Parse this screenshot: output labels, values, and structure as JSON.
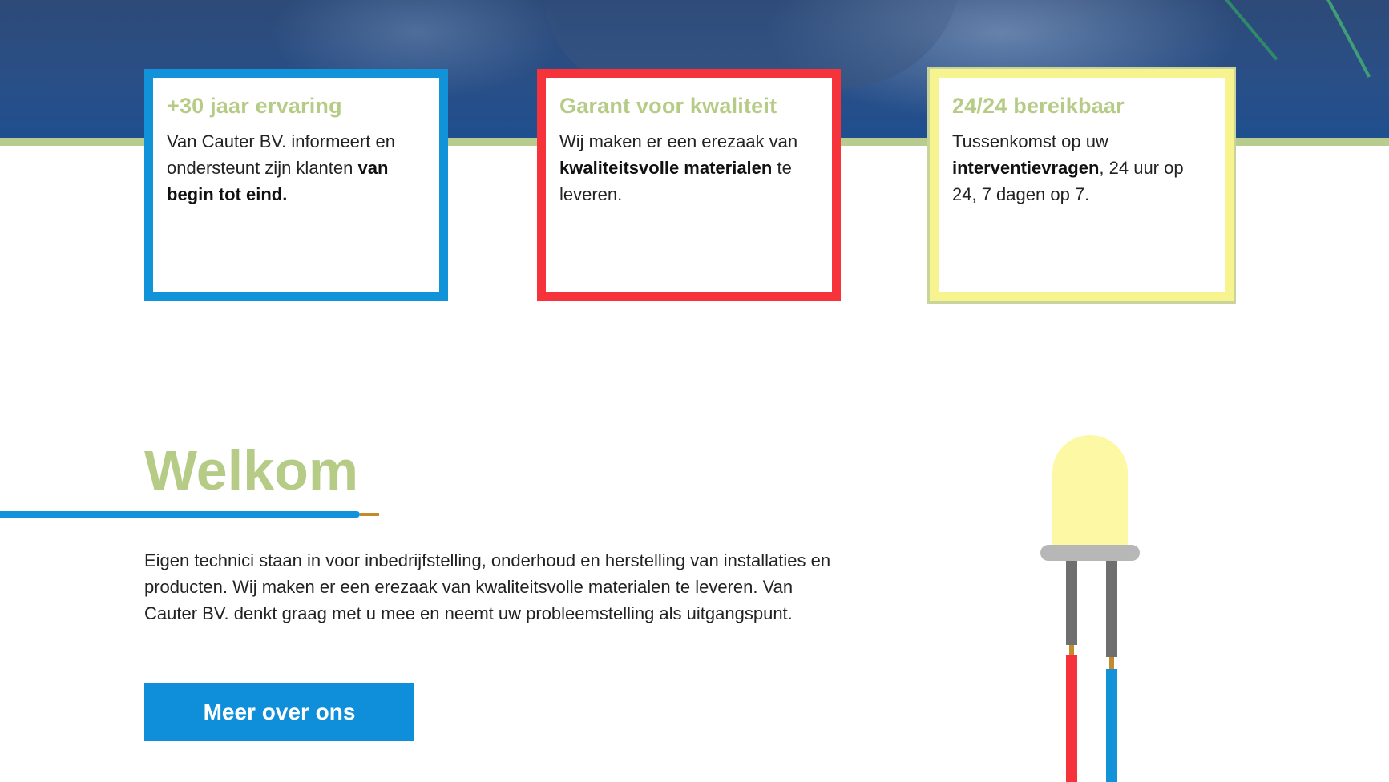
{
  "cards": [
    {
      "title": "+30 jaar ervaring",
      "text_before": "Van Cauter BV. informeert en ondersteunt zijn klanten ",
      "text_bold": "van begin tot eind.",
      "text_after": "",
      "border_color": "#1192d9"
    },
    {
      "title": "Garant voor kwaliteit",
      "text_before": "Wij maken er een erezaak van ",
      "text_bold": "kwaliteitsvolle materialen",
      "text_after": " te leveren.",
      "border_color": "#f6333a"
    },
    {
      "title": "24/24 bereikbaar",
      "text_before": "Tussenkomst op uw ",
      "text_bold": "interventievragen",
      "text_after": ", 24 uur op 24, 7 dagen op 7.",
      "border_color": "#f7f38f"
    }
  ],
  "welcome": {
    "title": "Welkom",
    "body": "Eigen technici staan in voor inbedrijfstelling, onderhoud en herstelling van installaties en producten. Wij maken er een erezaak van kwaliteitsvolle materialen te leveren. Van Cauter BV. denkt graag met u mee en neemt uw probleemstelling als uitgangspunt.",
    "button_label": "Meer over ons"
  },
  "colors": {
    "accent_green": "#b6cc86",
    "accent_blue": "#1192d9",
    "accent_red": "#f6333a",
    "accent_yellow": "#f7f38f"
  },
  "icons": {
    "led": "led-bulb-icon"
  }
}
